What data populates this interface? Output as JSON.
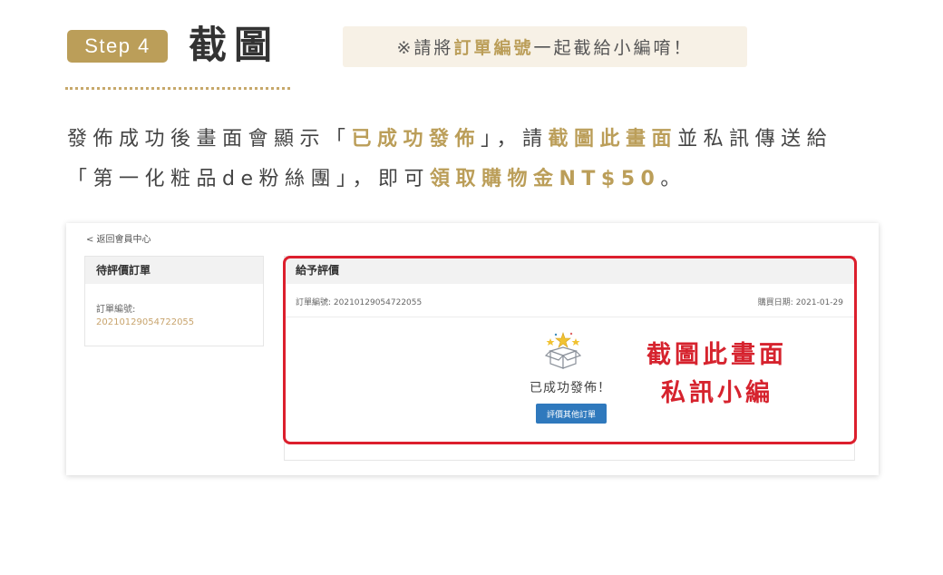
{
  "header": {
    "step_label": "Step 4",
    "title": "截圖",
    "note": {
      "prefix": "※請將",
      "highlight": "訂單編號",
      "suffix": "一起截給小編唷！"
    }
  },
  "description": {
    "line1": {
      "a": "發佈成功後畫面會顯示「",
      "hl1": "已成功發佈",
      "b": "」，請",
      "hl2": "截圖此畫面",
      "c": "並私訊傳送給"
    },
    "line2": {
      "a": "「第一化粧品de粉絲團」，即可",
      "hl": "領取購物金NT$50",
      "b": "。"
    }
  },
  "screenshot": {
    "back_link": "< 返回會員中心",
    "sidebar": {
      "title": "待評價訂單",
      "order_label": "訂單編號:",
      "order_number": "20210129054722055"
    },
    "main": {
      "title": "給予評價",
      "order_line": "訂單編號: 20210129054722055",
      "date_line": "購買日期: 2021-01-29",
      "success_text": "已成功發佈！",
      "button_label": "評價其他訂單",
      "icon": "gift-box-stars-icon"
    }
  },
  "overlay": {
    "line1": "截圖此畫面",
    "line2": "私訊小編"
  },
  "colors": {
    "gold": "#bb9e59",
    "red": "#dc1f2d",
    "blue_button": "#2f79bd"
  }
}
